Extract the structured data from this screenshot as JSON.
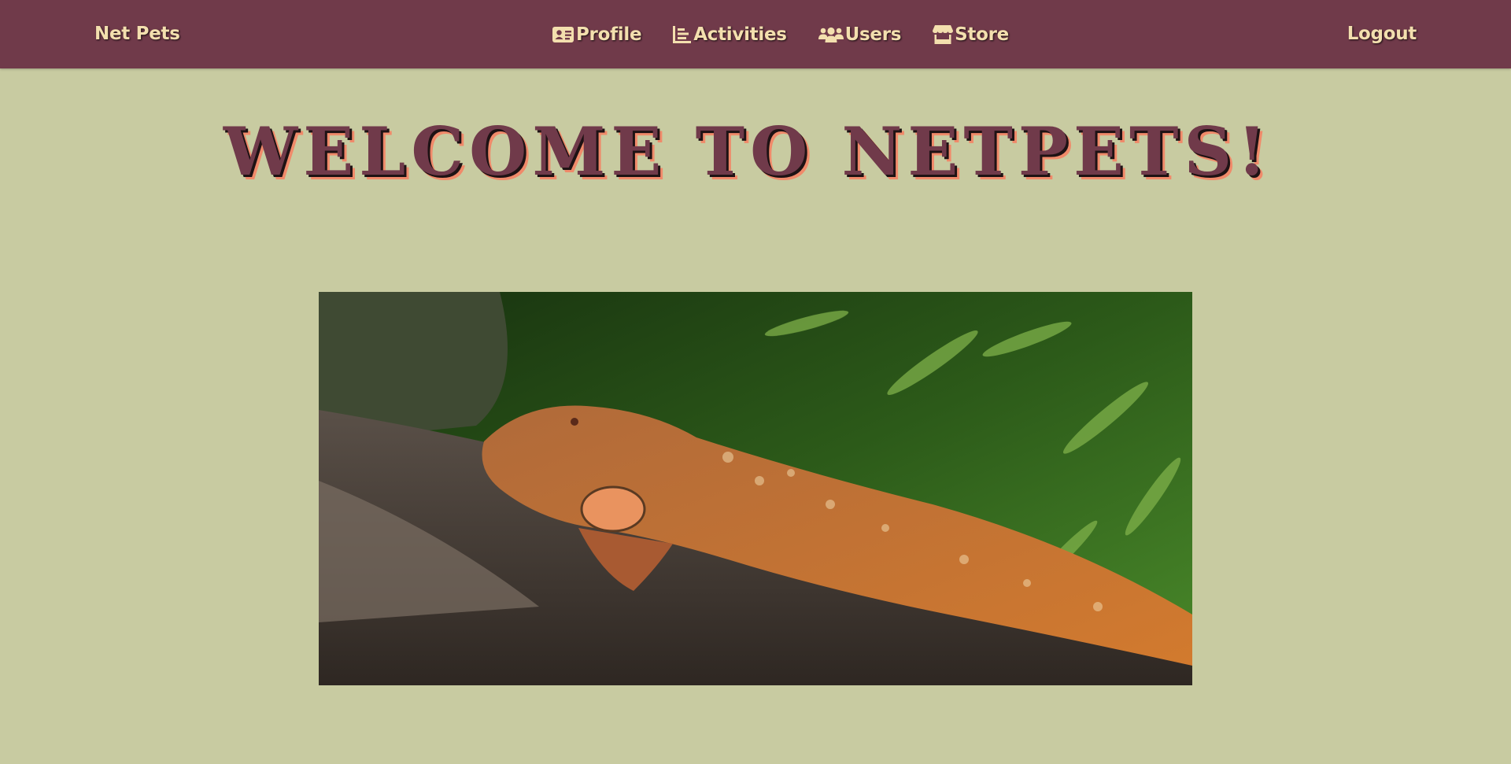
{
  "navbar": {
    "brand": "Net Pets",
    "links": [
      {
        "label": "Profile",
        "icon": "id-card-icon"
      },
      {
        "label": "Activities",
        "icon": "chart-bar-icon"
      },
      {
        "label": "Users",
        "icon": "users-icon"
      },
      {
        "label": "Store",
        "icon": "store-icon"
      }
    ],
    "logout": "Logout"
  },
  "main": {
    "headline": "WELCOME TO NETPETS!",
    "hero_image": "iguana-photo"
  },
  "colors": {
    "navbar_bg": "#703a4a",
    "nav_text": "#f3dfae",
    "page_bg": "#c8cba1",
    "headline": "#703a4a",
    "headline_shadow": "#f08a6a"
  }
}
